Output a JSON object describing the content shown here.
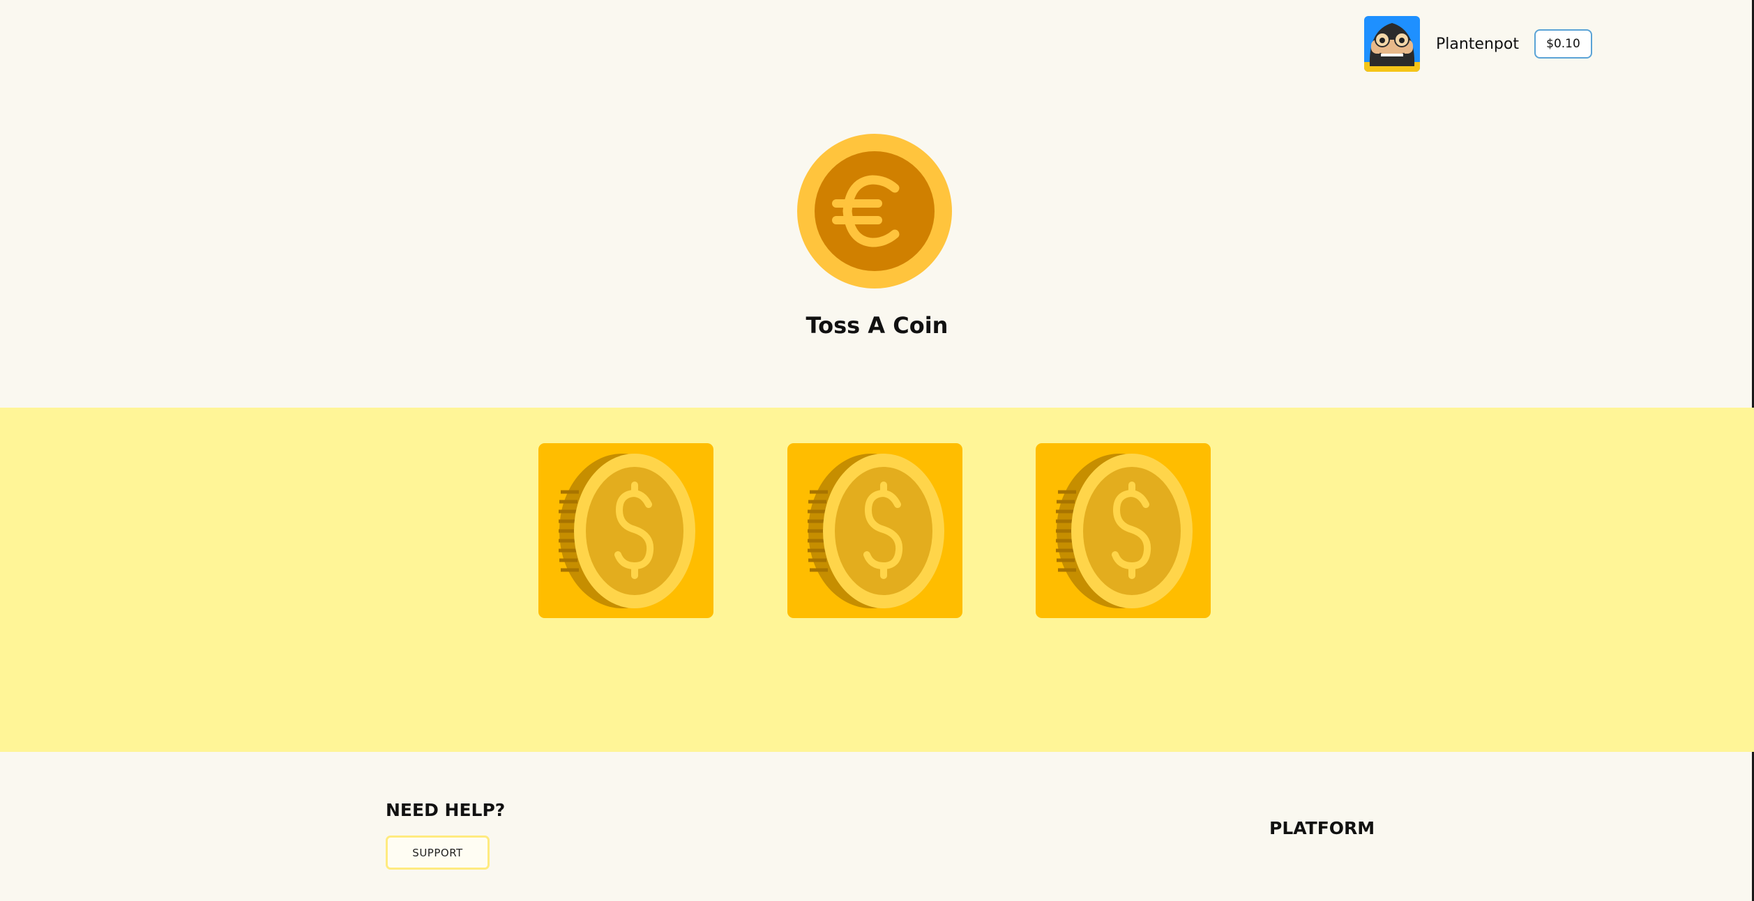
{
  "header": {
    "username": "Plantenpot",
    "balance": "$0.10"
  },
  "hero": {
    "title": "Toss A Coin",
    "icon": "euro-coin-icon"
  },
  "coin_options": [
    {
      "icon": "dollar-coin-icon"
    },
    {
      "icon": "dollar-coin-icon"
    },
    {
      "icon": "dollar-coin-icon"
    }
  ],
  "footer": {
    "help_title": "NEED HELP?",
    "support_label": "SUPPORT",
    "platform_title": "PLATFORM"
  },
  "colors": {
    "page_bg": "#faf8f0",
    "band_bg": "#fff597",
    "tile_bg": "#ffbd00",
    "accent_border": "#5aa3d6"
  }
}
